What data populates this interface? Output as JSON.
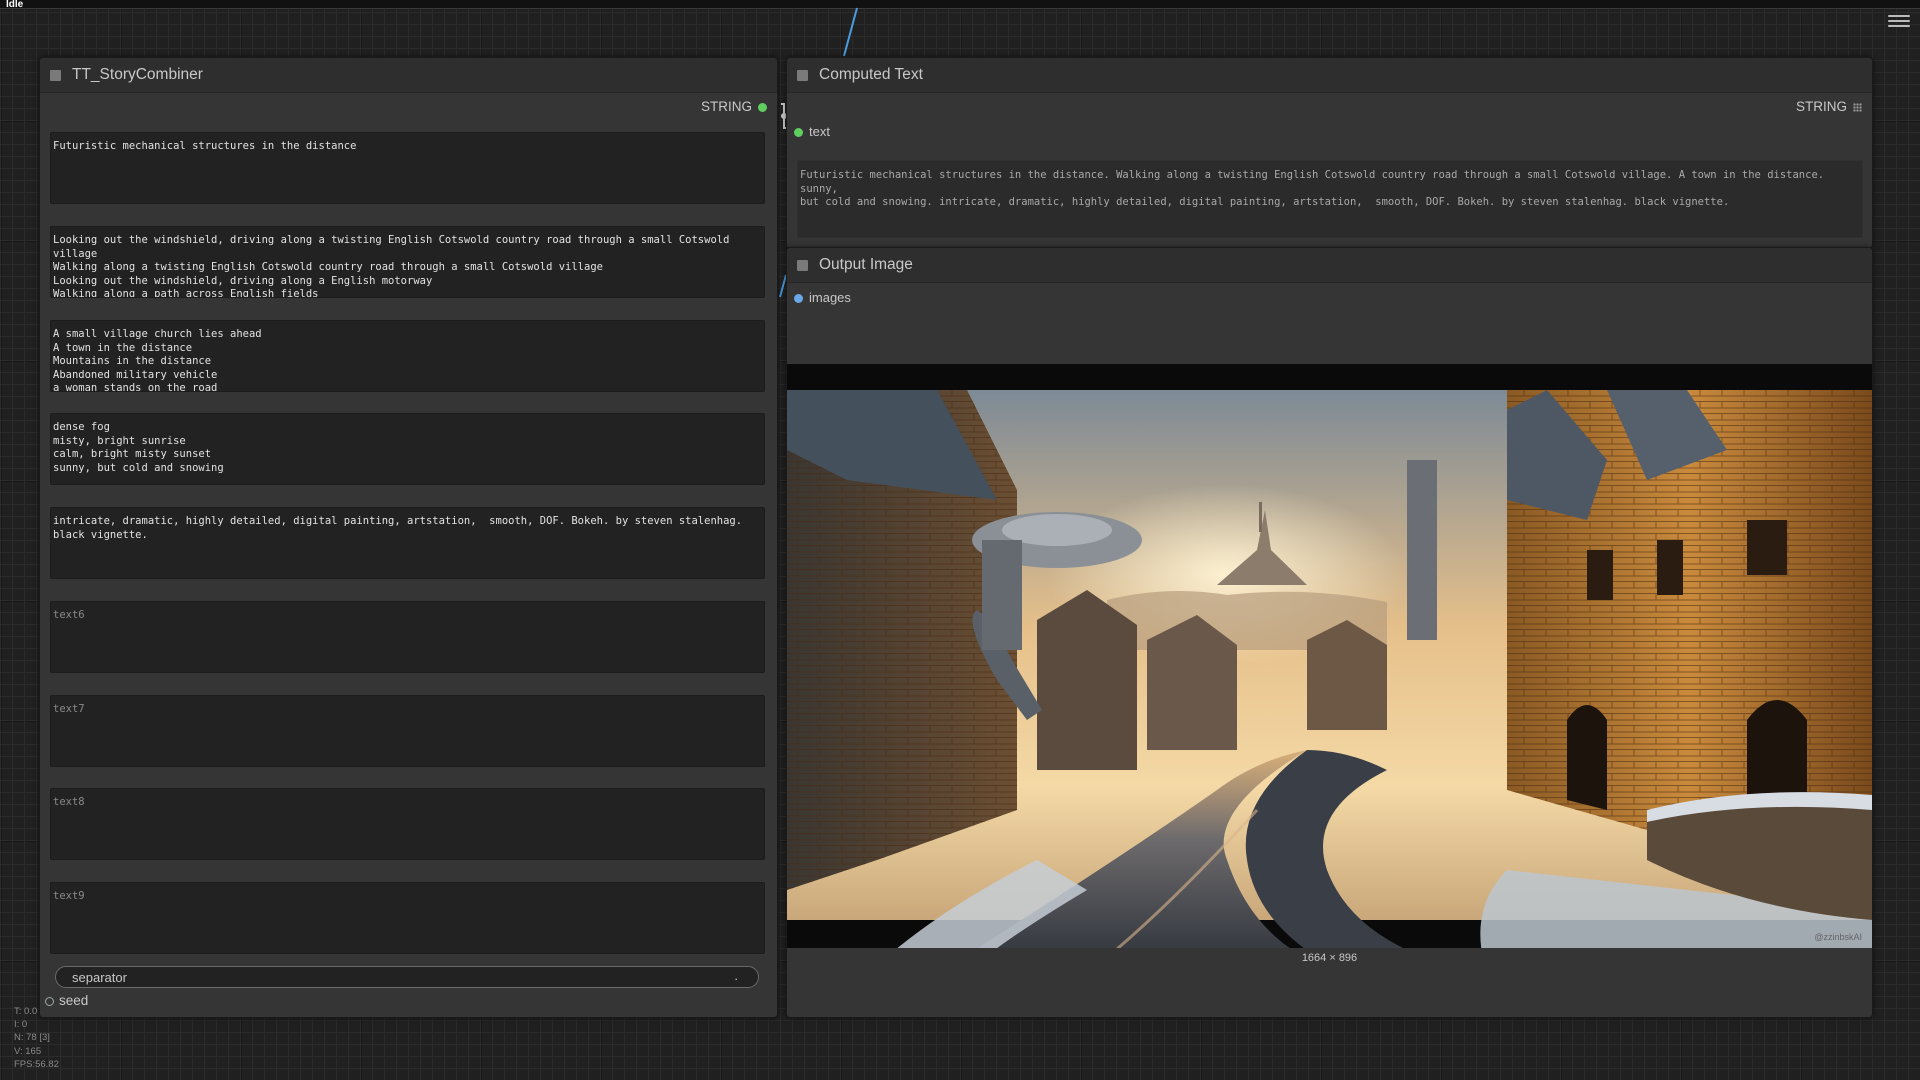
{
  "status": "Idle",
  "story_combiner": {
    "title": "TT_StoryCombiner",
    "output_label": "STRING",
    "texts": [
      "Futuristic mechanical structures in the distance",
      "Looking out the windshield, driving along a twisting English Cotswold country road through a small Cotswold village\nWalking along a twisting English Cotswold country road through a small Cotswold village\nLooking out the windshield, driving along a English motorway\nWalking along a path across English fields",
      "A small village church lies ahead\nA town in the distance\nMountains in the distance\nAbandoned military vehicle\na woman stands on the road",
      "dense fog\nmisty, bright sunrise\ncalm, bright misty sunset\nsunny, but cold and snowing",
      "intricate, dramatic, highly detailed, digital painting, artstation,  smooth, DOF. Bokeh. by steven stalenhag. black vignette."
    ],
    "placeholders": [
      "text6",
      "text7",
      "text8",
      "text9"
    ],
    "separator_label": "separator",
    "separator_value": ".",
    "seed_label": "seed"
  },
  "computed_text": {
    "title": "Computed Text",
    "output_label": "STRING",
    "input_label": "text",
    "value": "Futuristic mechanical structures in the distance. Walking along a twisting English Cotswold country road through a small Cotswold village. A town in the distance. sunny,\nbut cold and snowing. intricate, dramatic, highly detailed, digital painting, artstation,  smooth, DOF. Bokeh. by steven stalenhag. black vignette."
  },
  "output_image": {
    "title": "Output Image",
    "input_label": "images",
    "dimensions": "1664 × 896",
    "watermark": "@zzinbskAI"
  },
  "stats": [
    "T: 0.0",
    "I: 0",
    "N: 78 [3]",
    "V: 165",
    "FPS:56.82"
  ],
  "colors": {
    "link_blue": "#4a9be0",
    "slot_green": "#5fd05f",
    "slot_blue": "#6aa8e8"
  }
}
